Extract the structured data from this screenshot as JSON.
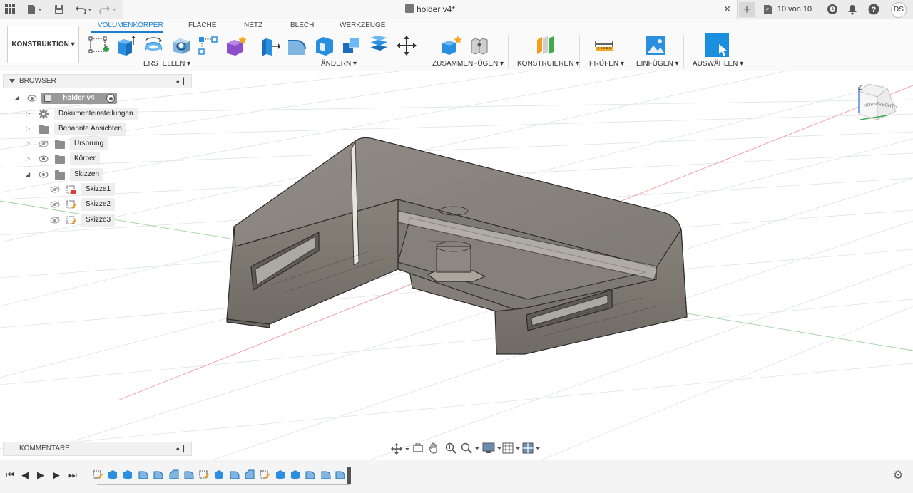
{
  "window": {
    "doc_title": "holder v4*",
    "version_text": "10 von 10",
    "user_initials": "DS"
  },
  "ribbon": {
    "workspace": "KONSTRUKTION ▾",
    "tabs": [
      {
        "label": "VOLUMENKÖRPER",
        "active": true
      },
      {
        "label": "FLÄCHE"
      },
      {
        "label": "NETZ"
      },
      {
        "label": "BLECH"
      },
      {
        "label": "WERKZEUGE"
      }
    ],
    "groups": {
      "create": "ERSTELLEN ▾",
      "modify": "ÄNDERN ▾",
      "assemble": "ZUSAMMENFÜGEN ▾",
      "construct": "KONSTRUIEREN ▾",
      "inspect": "PRÜFEN ▾",
      "insert": "EINFÜGEN ▾",
      "select": "AUSWÄHLEN ▾"
    }
  },
  "browser": {
    "title": "BROWSER",
    "root": "holder v4",
    "items": [
      {
        "label": "Dokumenteinstellungen"
      },
      {
        "label": "Benannte Ansichten"
      },
      {
        "label": "Ursprung"
      },
      {
        "label": "Körper"
      },
      {
        "label": "Skizzen"
      }
    ],
    "sketches": [
      {
        "label": "Skizze1"
      },
      {
        "label": "Skizze2"
      },
      {
        "label": "Skizze3"
      }
    ]
  },
  "comments": {
    "title": "KOMMENTARE"
  },
  "viewcube": {
    "front_label": "VORNE",
    "right_label": "RECHTS",
    "axis_label": "Z"
  },
  "colors": {
    "accent": "#1a7fd0",
    "body": "#8f8b85",
    "grid": "#d9dde2"
  }
}
